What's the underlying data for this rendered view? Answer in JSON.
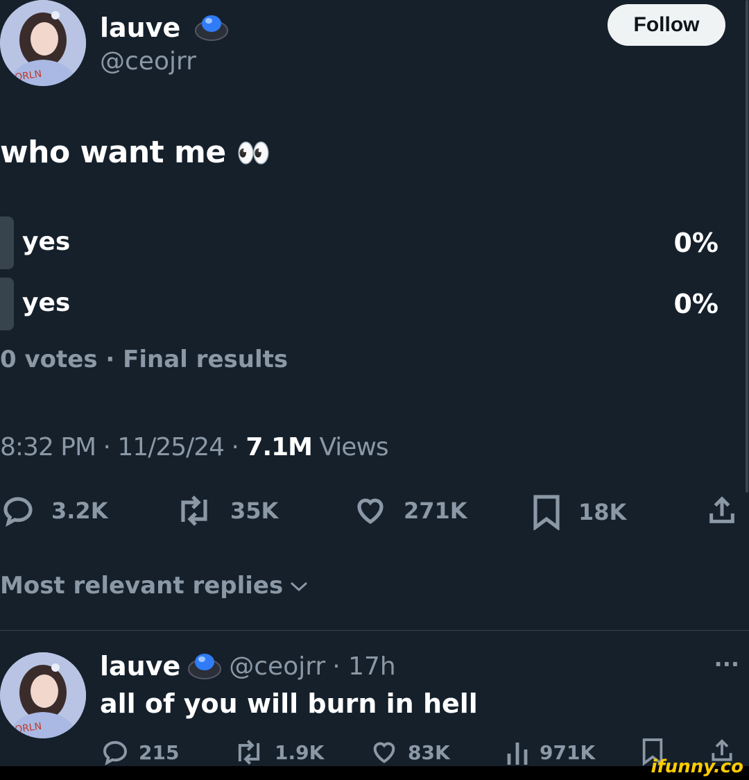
{
  "tweet": {
    "author_name": "lauve",
    "author_handle": "@ceojrr",
    "follow_label": "Follow",
    "text": "who want me",
    "emoji": "👀",
    "poll": {
      "options": [
        {
          "label": "yes",
          "percent": "0%"
        },
        {
          "label": "yes",
          "percent": "0%"
        }
      ],
      "summary": "0 votes · Final results"
    },
    "time": "8:32 PM · 11/25/24 · ",
    "views_count": "7.1M",
    "views_label": " Views",
    "actions": {
      "replies": "3.2K",
      "reposts": "35K",
      "likes": "271K",
      "bookmarks": "18K"
    }
  },
  "sort_label": "Most relevant replies",
  "reply": {
    "author_name": "lauve",
    "author_handle": "@ceojrr",
    "age": "· 17h",
    "more": "···",
    "text": "all of you will burn in hell",
    "actions": {
      "replies": "215",
      "reposts": "1.9K",
      "likes": "83K",
      "views": "971K"
    }
  },
  "watermark": "ifunny.co",
  "colors": {
    "background": "#15202b",
    "muted": "#8b98a5",
    "follow_bg": "#eff3f4",
    "badge_blue": "#2f7cf6",
    "watermark": "#ffcc00"
  }
}
